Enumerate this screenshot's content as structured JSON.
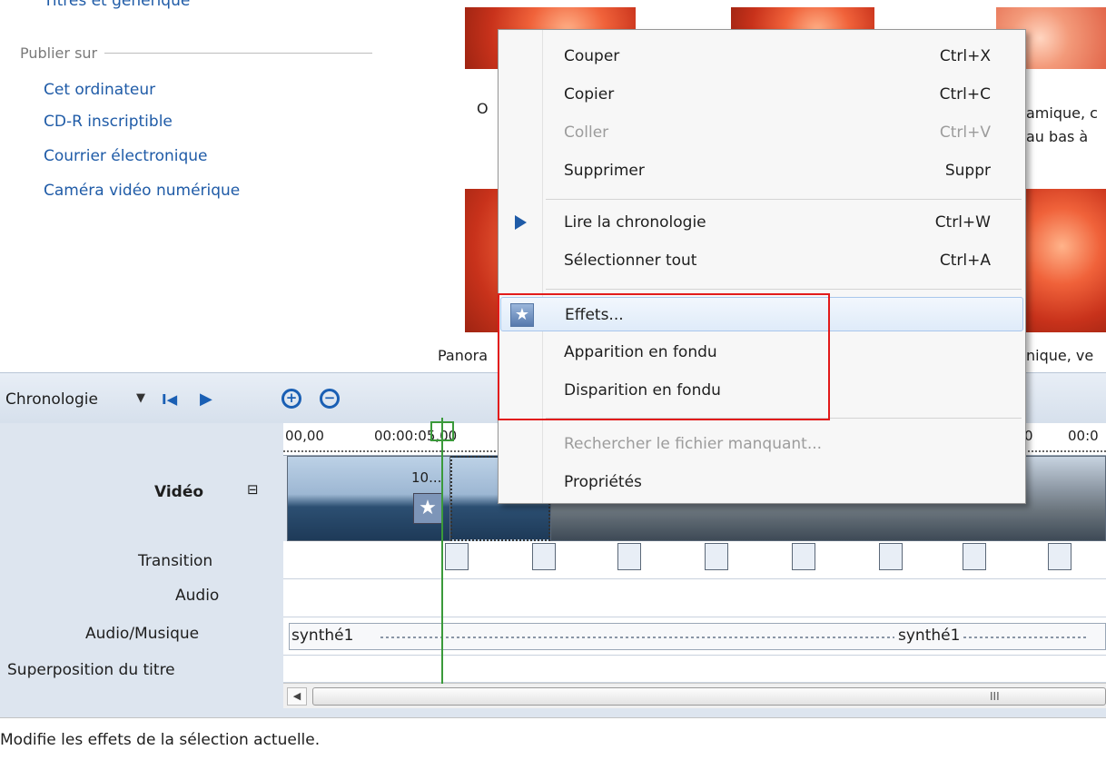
{
  "tasks": {
    "cut_title": "Titres et générique",
    "publish_heading": "Publier sur",
    "publish_links": [
      "Cet ordinateur",
      "CD-R inscriptible",
      "Courrier électronique",
      "Caméra vidéo numérique"
    ]
  },
  "effects_pane": {
    "labels": [
      "O",
      "amique, c",
      "au bas à",
      "Panora",
      "nique, ve"
    ]
  },
  "timeline": {
    "toolbar": {
      "mode_label": "Chronologie",
      "dropdown_glyph": "▼",
      "rewind_glyph": "I◀",
      "play_glyph": "▶"
    },
    "ruler": [
      "00,00",
      "00:00:05,00",
      "0",
      "00:0"
    ],
    "clip_caption": "10...",
    "tracks": {
      "video": "Vidéo",
      "collapse_glyph": "⊟",
      "transition": "Transition",
      "audio": "Audio",
      "audio_music": "Audio/Musique",
      "title_overlay": "Superposition du titre"
    },
    "audio_clips": [
      "synthé1",
      "synthé1"
    ],
    "scroll_left_glyph": "◀",
    "scroll_grip": "III"
  },
  "status_bar": {
    "text": "Modifie les effets de la sélection actuelle."
  },
  "context_menu": {
    "items": [
      {
        "label": "Couper",
        "shortcut": "Ctrl+X"
      },
      {
        "label": "Copier",
        "shortcut": "Ctrl+C"
      },
      {
        "label": "Coller",
        "shortcut": "Ctrl+V",
        "disabled": true
      },
      {
        "label": "Supprimer",
        "shortcut": "Suppr"
      },
      {
        "label": "Lire la chronologie",
        "shortcut": "Ctrl+W",
        "icon": "play-icon"
      },
      {
        "label": "Sélectionner tout",
        "shortcut": "Ctrl+A"
      },
      {
        "label": "Effets...",
        "icon": "effects-star-icon",
        "highlighted": true
      },
      {
        "label": "Apparition en fondu"
      },
      {
        "label": "Disparition en fondu"
      },
      {
        "label": "Rechercher le fichier manquant...",
        "disabled": true
      },
      {
        "label": "Propriétés"
      }
    ]
  },
  "colors": {
    "link_blue": "#1f5ba7",
    "highlight_red": "#e21a1a",
    "playhead_green": "#3a9a3a"
  }
}
